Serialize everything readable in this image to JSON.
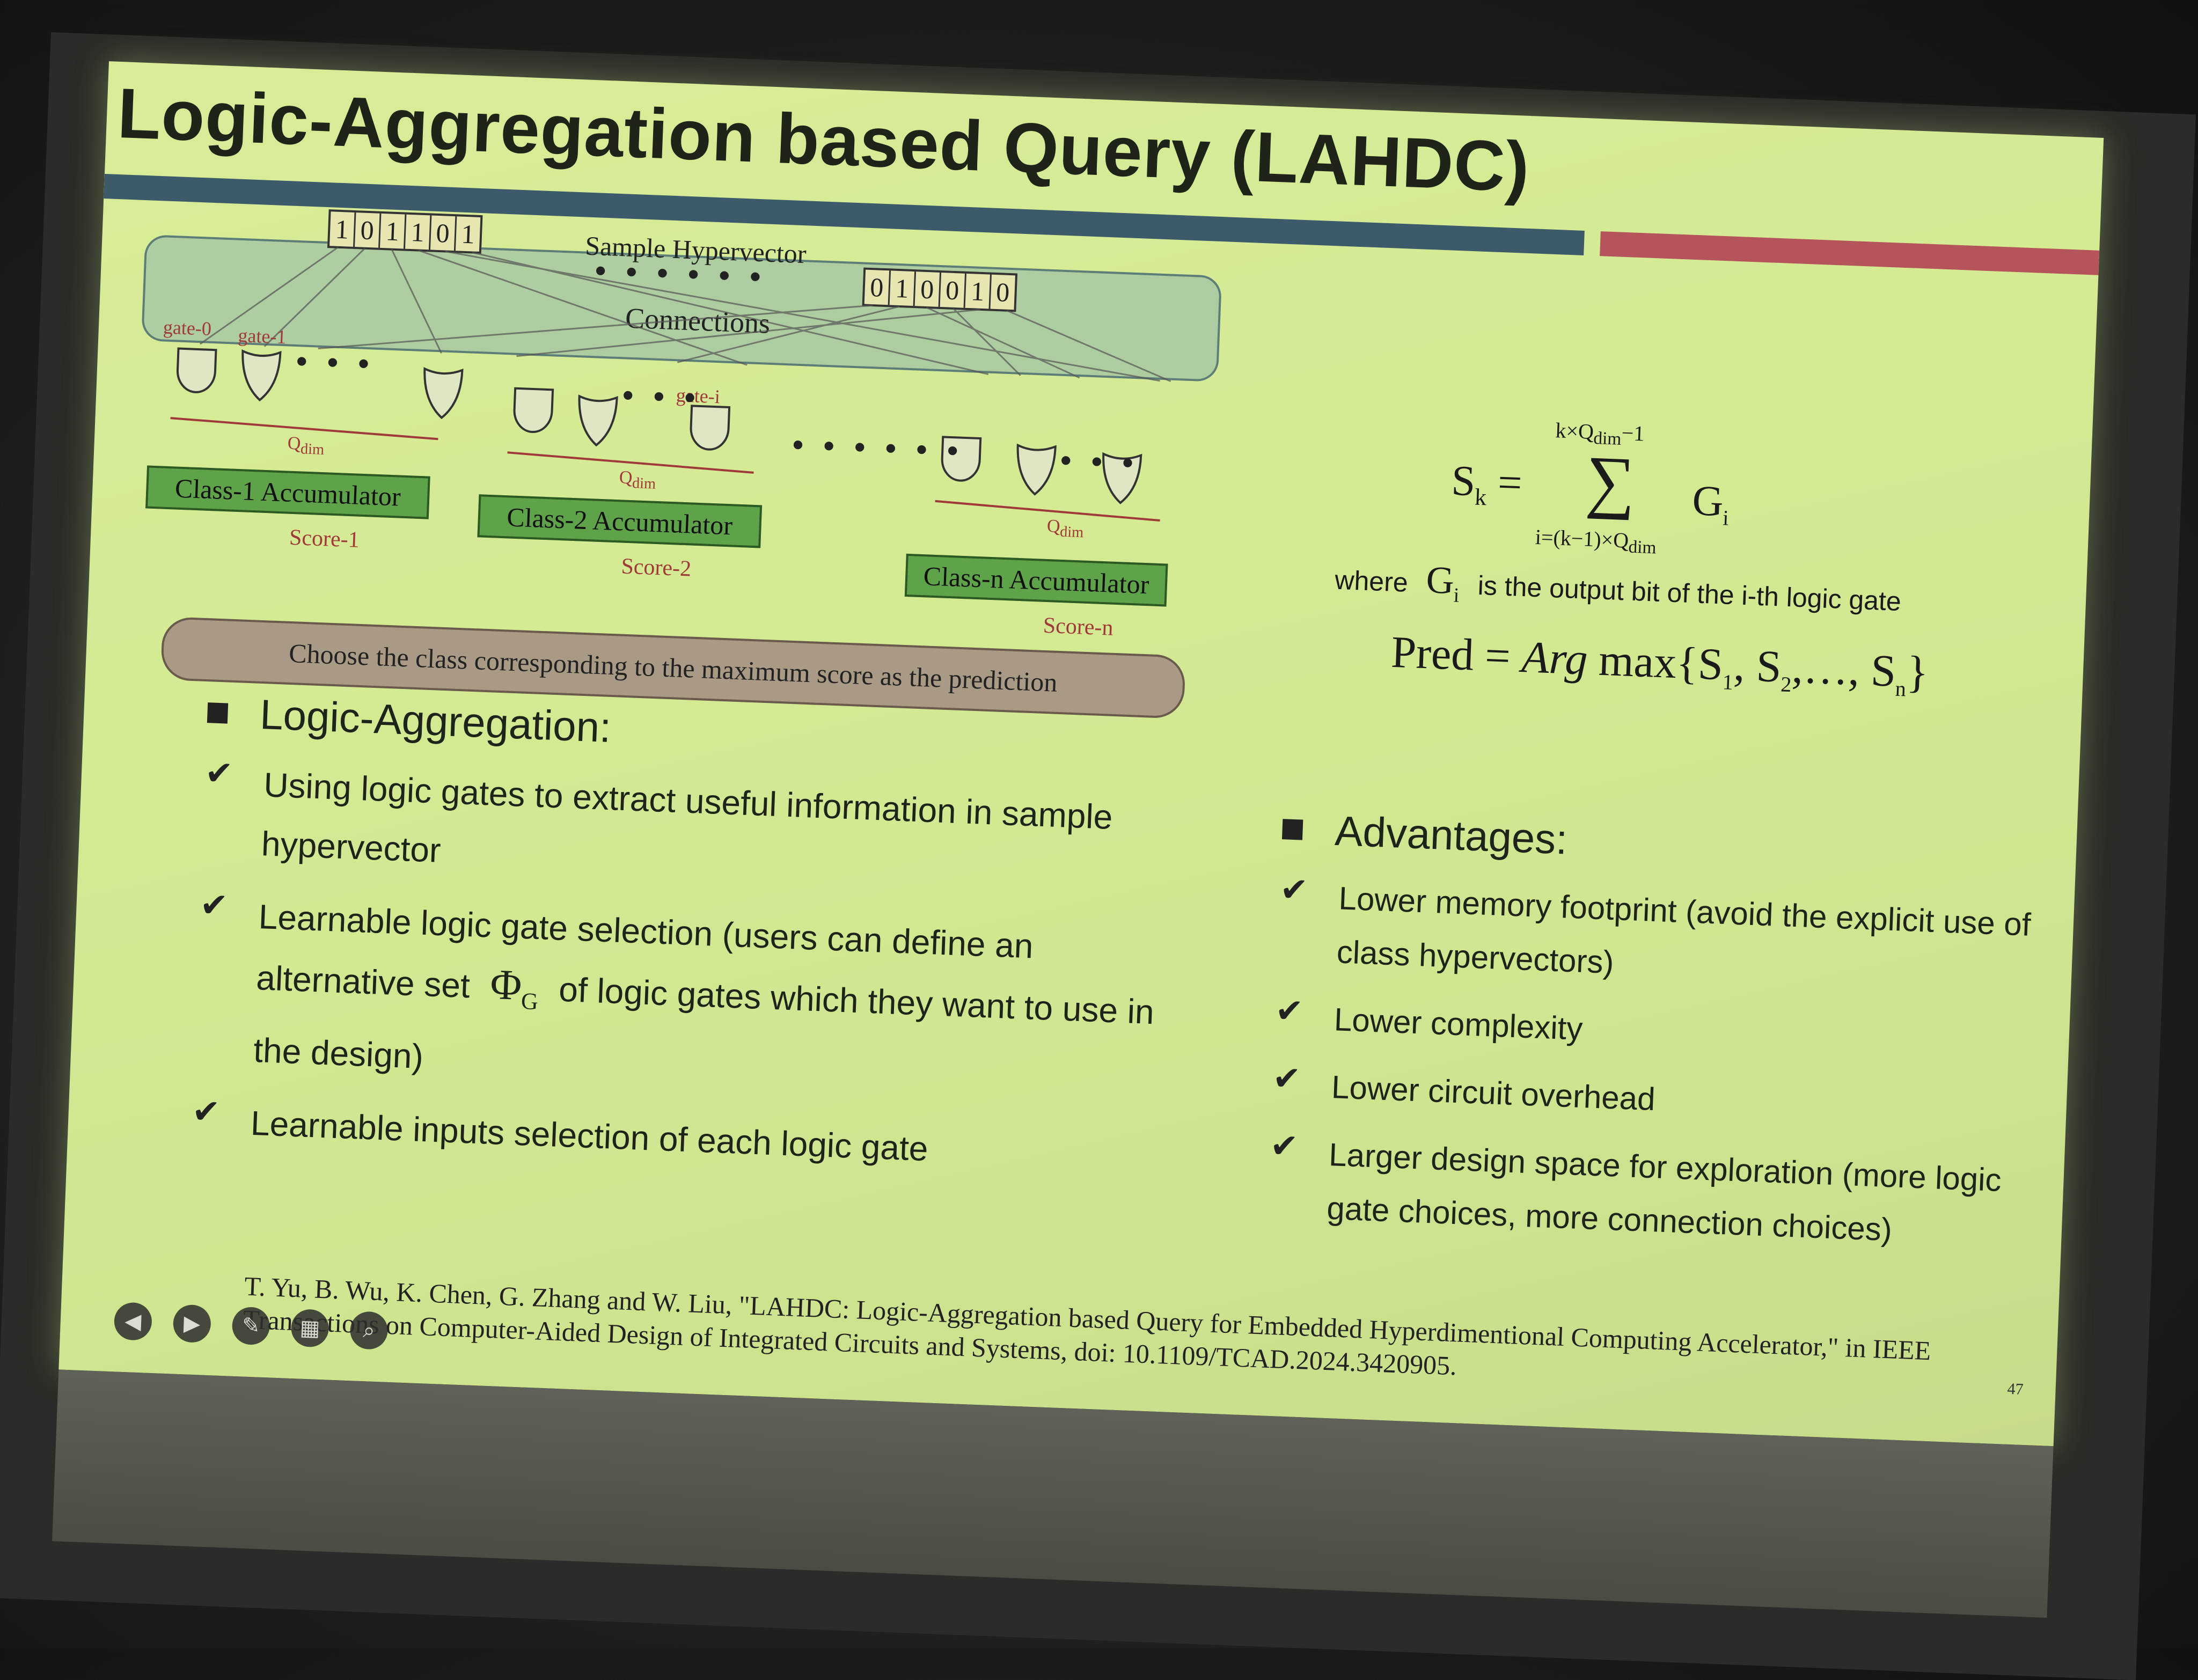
{
  "slide": {
    "title": "Logic-Aggregation based Query (LAHDC)",
    "colors": {
      "accent_dark": "#3c5a6a",
      "accent_red": "#b5545a",
      "slide_bg": "#d4ea93"
    },
    "page_number": "47"
  },
  "figure": {
    "bits_left": [
      "1",
      "0",
      "1",
      "1",
      "0",
      "1"
    ],
    "bits_right": [
      "0",
      "1",
      "0",
      "0",
      "1",
      "0"
    ],
    "hypervector_label": "Sample Hypervector",
    "connections_label": "Connections",
    "gate_labels": [
      "gate-0",
      "gate-1",
      "gate-i"
    ],
    "qdim_label": "Q",
    "qdim_sub": "dim",
    "accumulators": [
      "Class-1 Accumulator",
      "Class-2 Accumulator",
      "Class-n Accumulator"
    ],
    "scores": [
      "Score-1",
      "Score-2",
      "Score-n"
    ],
    "choose_label": "Choose the class corresponding to the maximum score as the prediction"
  },
  "formulas": {
    "sk_lhs": "S",
    "sk_lhs_sub": "k",
    "sum_upper": "k×Q",
    "sum_upper_sub": "dim",
    "sum_upper_tail": "−1",
    "sum_lower": "i=(k−1)×Q",
    "sum_lower_sub": "dim",
    "gi": "G",
    "gi_sub": "i",
    "where_prefix": "where",
    "where_suffix": "is the output bit of the i-th logic gate",
    "pred": "Pred = Arg max{S",
    "pred_rest": "1, S2,…, Sn}"
  },
  "logic_aggregation": {
    "heading": "Logic-Aggregation:",
    "items": [
      "Using logic gates to extract useful information in sample hypervector",
      "Learnable logic gate selection (users can define an alternative set",
      "of logic gates which they want to use in the design)",
      "Learnable inputs selection of each logic gate"
    ],
    "phi": "Φ",
    "phi_sub": "G"
  },
  "advantages": {
    "heading": "Advantages:",
    "items": [
      "Lower memory footprint (avoid the explicit use of class hypervectors)",
      "Lower complexity",
      "Lower circuit overhead",
      "Larger design space for exploration (more logic gate choices, more connection choices)"
    ]
  },
  "reference": "T. Yu, B. Wu, K. Chen, G. Zhang and W. Liu, \"LAHDC: Logic-Aggregation based Query for Embedded Hyperdimentional Computing Accelerator,\" in IEEE Transactions on Computer-Aided Design of Integrated Circuits and Systems, doi: 10.1109/TCAD.2024.3420905.",
  "toolbar": {
    "icons": [
      "back-icon",
      "play-icon",
      "pen-icon",
      "slides-icon",
      "zoom-icon"
    ]
  }
}
